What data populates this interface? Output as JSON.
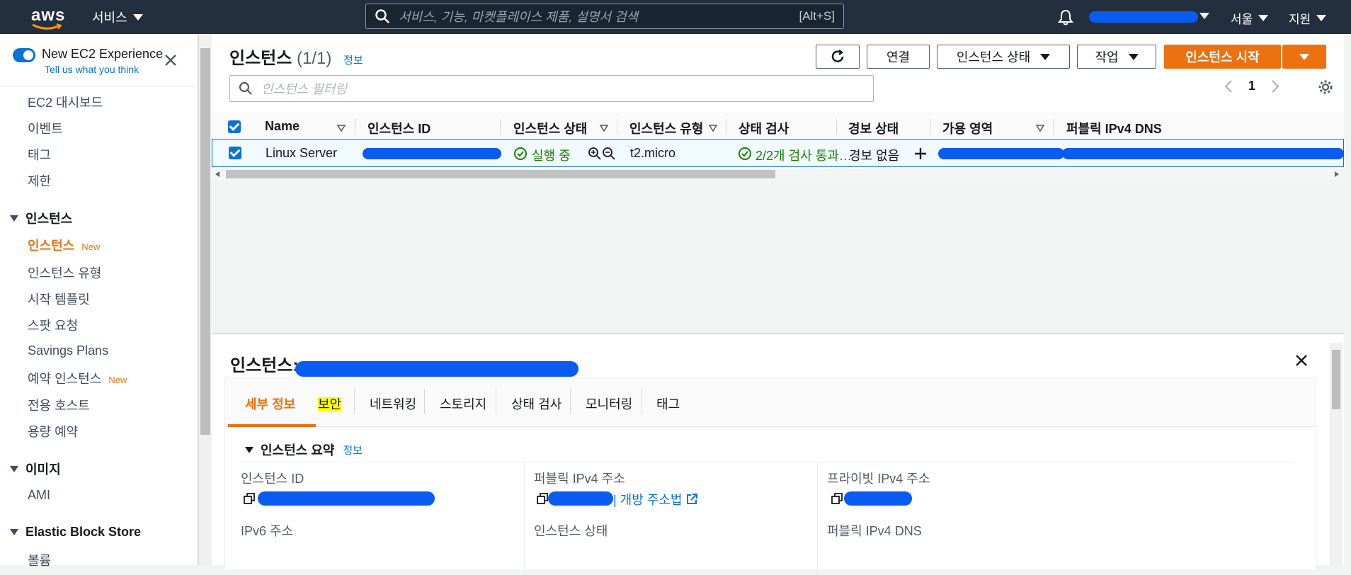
{
  "topnav": {
    "logo": "aws",
    "services_label": "서비스",
    "search_placeholder": "서비스, 기능, 마켓플레이스 제품, 설명서 검색",
    "search_shortcut": "[Alt+S]",
    "region_label": "서울",
    "support_label": "지원",
    "icons": [
      "search-icon",
      "bell-icon",
      "chevron-down-icon"
    ]
  },
  "sidebar": {
    "toggle_label": "New EC2 Experience",
    "toggle_on": true,
    "tell_us": "Tell us what you think",
    "items_top": [
      "EC2 대시보드",
      "이벤트",
      "태그",
      "제한"
    ],
    "section_instances": "인스턴스",
    "instances_items": [
      "인스턴스",
      "인스턴스 유형",
      "시작 템플릿",
      "스팟 요청",
      "Savings Plans",
      "예약 인스턴스",
      "전용 호스트",
      "용량 예약"
    ],
    "new_badge": "New",
    "section_images": "이미지",
    "images_items": [
      "AMI"
    ],
    "section_ebs": "Elastic Block Store",
    "ebs_items": [
      "볼륨"
    ]
  },
  "instances_panel": {
    "title": "인스턴스",
    "count": "(1/1)",
    "info": "정보",
    "buttons": {
      "connect": "연결",
      "state": "인스턴스 상태",
      "actions": "작업",
      "launch": "인스턴스 시작"
    },
    "filter_placeholder": "인스턴스 필터링",
    "page": "1",
    "columns": [
      "Name",
      "인스턴스 ID",
      "인스턴스 상태",
      "인스턴스 유형",
      "상태 검사",
      "경보 상태",
      "가용 영역",
      "퍼블릭 IPv4 DNS"
    ],
    "row": {
      "name": "Linux Server",
      "state": "실행 중",
      "type": "t2.micro",
      "checks": "2/2개 검사 통과…",
      "alarm": "경보 없음"
    },
    "accent": "#ec7211",
    "link_color": "#0972d3",
    "ok_color": "#1d8102"
  },
  "detail": {
    "title": "인스턴스:",
    "tabs": [
      "세부 정보",
      "보안",
      "네트워킹",
      "스토리지",
      "상태 검사",
      "모니터링",
      "태그"
    ],
    "summary_title": "인스턴스 요약",
    "info": "정보",
    "labels": {
      "instance_id": "인스턴스 ID",
      "public_ipv4": "퍼블릭 IPv4 주소",
      "private_ipv4": "프라이빗 IPv4 주소",
      "ipv6": "IPv6 주소",
      "instance_state": "인스턴스 상태",
      "public_dns": "퍼블릭 IPv4 DNS"
    },
    "open_address": "| 개방 주소법"
  }
}
